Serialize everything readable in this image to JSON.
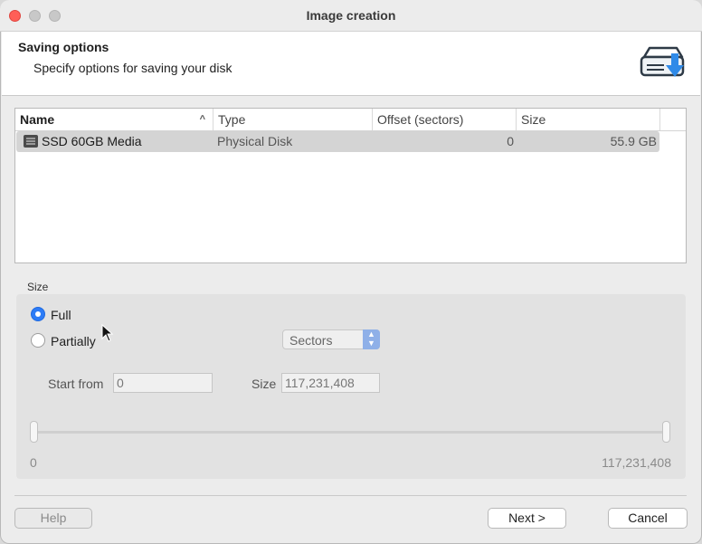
{
  "window": {
    "title": "Image creation"
  },
  "header": {
    "title": "Saving options",
    "subtitle": "Specify options for saving your disk",
    "icon": "disk-download-icon"
  },
  "table": {
    "columns": [
      "Name",
      "Type",
      "Offset (sectors)",
      "Size"
    ],
    "sort_column": "Name",
    "rows": [
      {
        "name": "SSD 60GB Media",
        "type": "Physical Disk",
        "offset": "0",
        "size": "55.9 GB",
        "icon": "drive-icon"
      }
    ]
  },
  "size_group": {
    "label": "Size",
    "options": [
      {
        "label": "Full",
        "selected": true
      },
      {
        "label": "Partially",
        "selected": false
      }
    ],
    "unit": "Sectors",
    "start_label": "Start from",
    "start_value": "0",
    "size_label": "Size",
    "size_value": "117,231,408",
    "range_min": "0",
    "range_max": "117,231,408"
  },
  "buttons": {
    "help": "Help",
    "next": "Next >",
    "cancel": "Cancel"
  },
  "colors": {
    "accent": "#2d7cf6",
    "close": "#ff5f57",
    "selection": "#d4d4d4"
  }
}
